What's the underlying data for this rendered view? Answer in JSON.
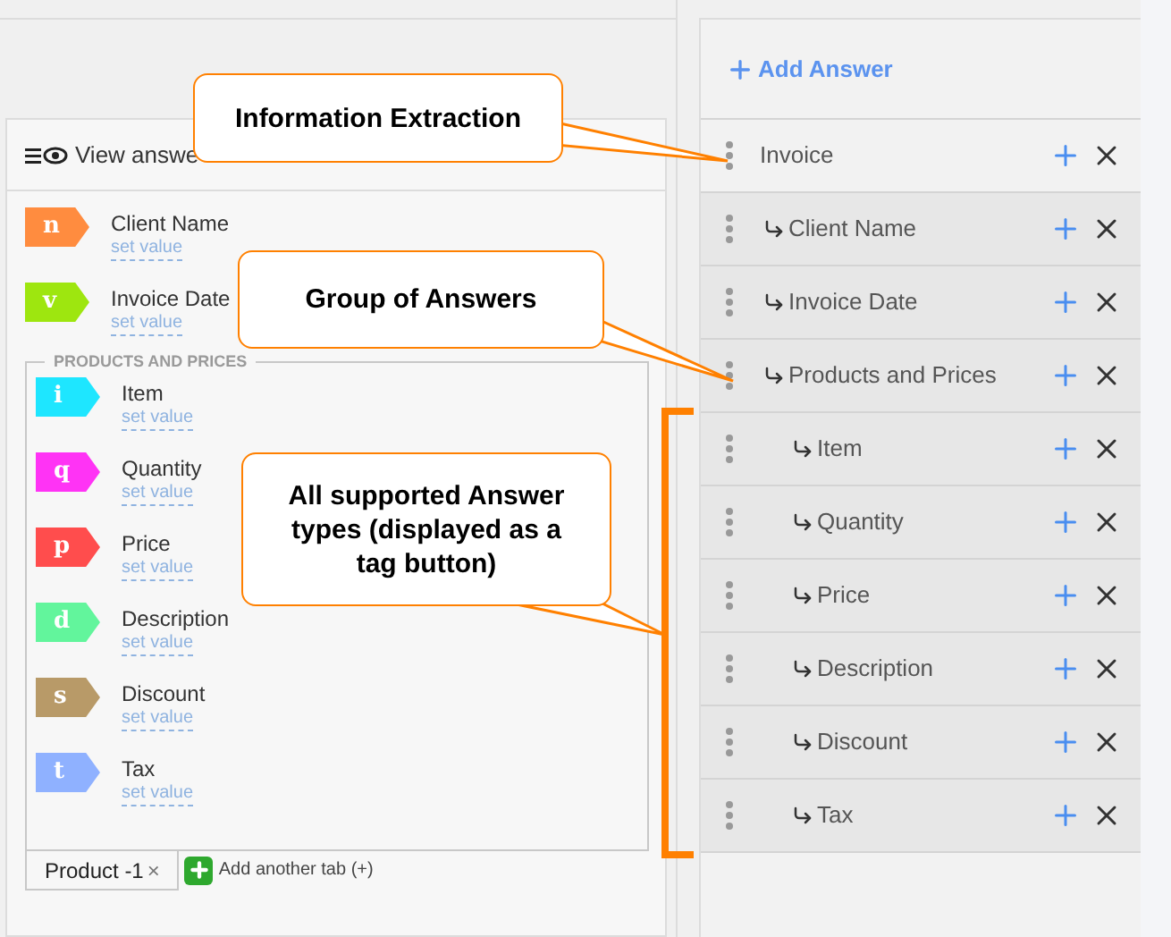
{
  "toolbar": {
    "label": "View answe"
  },
  "answers": [
    {
      "tag": "n",
      "color": "#ff8c3f",
      "label": "Client Name",
      "link": "set value"
    },
    {
      "tag": "v",
      "color": "#9ee60f",
      "label": "Invoice Date",
      "link": "set value"
    }
  ],
  "group": {
    "title": "PRODUCTS AND PRICES",
    "answers": [
      {
        "tag": "i",
        "color": "#1ee6ff",
        "label": "Item",
        "link": "set value"
      },
      {
        "tag": "q",
        "color": "#ff33f5",
        "label": "Quantity",
        "link": "set value"
      },
      {
        "tag": "p",
        "color": "#ff4d4d",
        "label": "Price",
        "link": "set value"
      },
      {
        "tag": "d",
        "color": "#62f59c",
        "label": "Description",
        "link": "set value"
      },
      {
        "tag": "s",
        "color": "#b89a68",
        "label": "Discount",
        "link": "set value"
      },
      {
        "tag": "t",
        "color": "#8fb1ff",
        "label": "Tax",
        "link": "set value"
      }
    ],
    "tabs": [
      {
        "label": "Product -1",
        "close": "×",
        "selected": true
      }
    ],
    "add_tab": "Add another tab (+)"
  },
  "add_answer": "Add Answer",
  "tree": [
    {
      "label": "Invoice",
      "children": [
        {
          "label": "Client Name"
        },
        {
          "label": "Invoice Date"
        },
        {
          "label": "Products and Prices",
          "children": [
            {
              "label": "Item"
            },
            {
              "label": "Quantity"
            },
            {
              "label": "Price"
            },
            {
              "label": "Description"
            },
            {
              "label": "Discount"
            },
            {
              "label": "Tax"
            }
          ]
        }
      ]
    }
  ],
  "callouts": [
    {
      "text": "Information Extraction"
    },
    {
      "text": "Group of Answers"
    },
    {
      "text": "All supported Answer types (displayed as a tag button)"
    }
  ]
}
